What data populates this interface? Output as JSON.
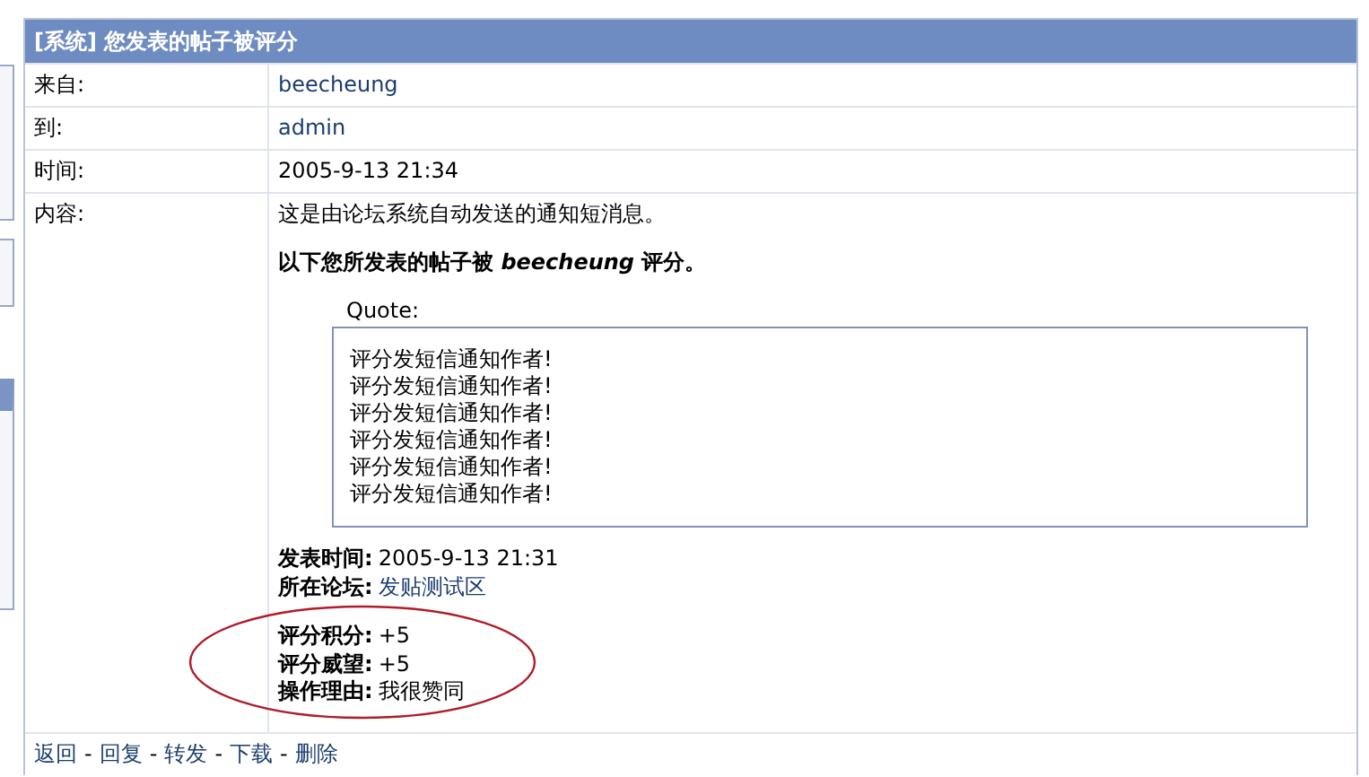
{
  "message": {
    "title": "[系统] 您发表的帖子被评分",
    "fields": [
      {
        "label": "来自:",
        "value": "beecheung",
        "kind": "link"
      },
      {
        "label": "到:",
        "value": "admin",
        "kind": "link"
      },
      {
        "label": "时间:",
        "value": "2005-9-13 21:34",
        "kind": "text"
      }
    ],
    "content_label": "内容:",
    "paragraphs": [
      "这是由论坛系统自动发送的通知短消息。",
      "以下您所发表的帖子被 *beecheung* 评分。"
    ],
    "quote": {
      "label": "Quote:",
      "lines": [
        "评分发短信通知作者!",
        "评分发短信通知作者!",
        "评分发短信通知作者!",
        "评分发短信通知作者!",
        "评分发短信通知作者!",
        "评分发短信通知作者!"
      ]
    },
    "detail_groups": [
      {
        "circled": false,
        "items": [
          {
            "label": "发表时间:",
            "value": "2005-9-13 21:31",
            "kind": "text"
          },
          {
            "label": "所在论坛:",
            "value": "发贴测试区",
            "kind": "link"
          }
        ]
      },
      {
        "circled": true,
        "items": [
          {
            "label": "评分积分:",
            "value": "+5",
            "kind": "text"
          },
          {
            "label": "评分威望:",
            "value": "+5",
            "kind": "text"
          },
          {
            "label": "操作理由:",
            "value": "我很赞同",
            "kind": "text"
          }
        ]
      }
    ],
    "footer": [
      {
        "kind": "link",
        "text": "返回"
      },
      {
        "kind": "separator",
        "text": "-"
      },
      {
        "kind": "link",
        "text": "回复"
      },
      {
        "kind": "separator",
        "text": "-"
      },
      {
        "kind": "link",
        "text": "转发"
      },
      {
        "kind": "separator",
        "text": "-"
      },
      {
        "kind": "link",
        "text": "下载"
      },
      {
        "kind": "separator",
        "text": "-"
      },
      {
        "kind": "link",
        "text": "删除"
      }
    ]
  }
}
